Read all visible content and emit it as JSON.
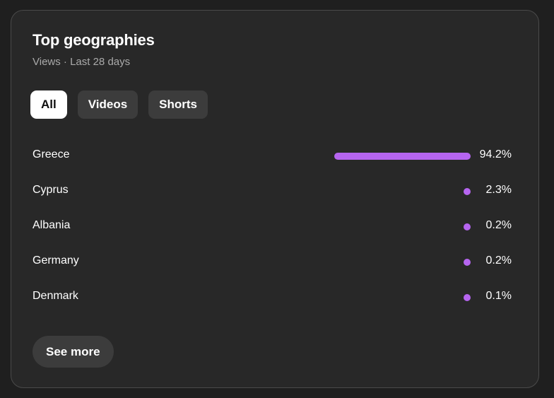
{
  "card": {
    "title": "Top geographies",
    "subtitle": "Views · Last 28 days"
  },
  "filters": [
    {
      "label": "All",
      "active": true
    },
    {
      "label": "Videos",
      "active": false
    },
    {
      "label": "Shorts",
      "active": false
    }
  ],
  "geographies": [
    {
      "country": "Greece",
      "percent_label": "94.2%",
      "share": 94.2
    },
    {
      "country": "Cyprus",
      "percent_label": "2.3%",
      "share": 2.3
    },
    {
      "country": "Albania",
      "percent_label": "0.2%",
      "share": 0.2
    },
    {
      "country": "Germany",
      "percent_label": "0.2%",
      "share": 0.2
    },
    {
      "country": "Denmark",
      "percent_label": "0.1%",
      "share": 0.1
    }
  ],
  "see_more_label": "See more",
  "colors": {
    "bar": "#b665f0",
    "card_bg": "#282828",
    "chip_bg": "#3c3c3c",
    "chip_active_bg": "#ffffff"
  }
}
